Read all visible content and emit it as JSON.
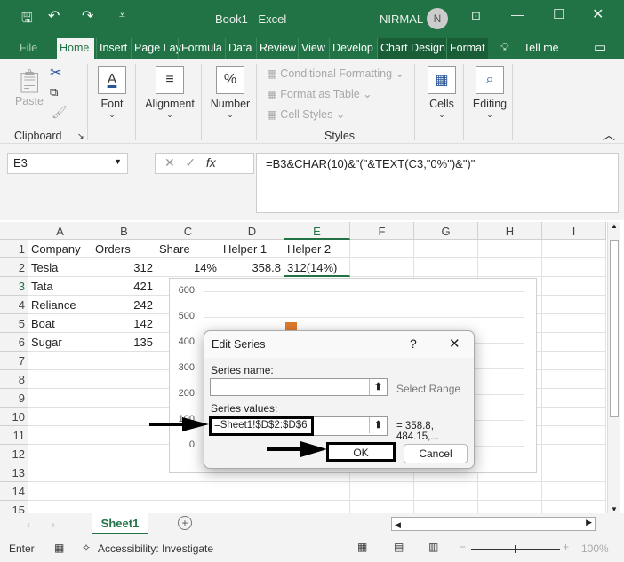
{
  "titlebar": {
    "title": "Book1  -  Excel",
    "user": "NIRMAL",
    "avatar": "N"
  },
  "tabs": [
    "File",
    "Home",
    "Insert",
    "Page Lay",
    "Formula",
    "Data",
    "Review",
    "View",
    "Develop",
    "Chart Design",
    "Format",
    "Tell me"
  ],
  "ribbon": {
    "paste": "Paste",
    "clipboard": "Clipboard",
    "font": "Font",
    "alignment": "Alignment",
    "number": "Number",
    "conditional": "Conditional Formatting",
    "format_table": "Format as Table",
    "cell_styles": "Cell Styles",
    "styles": "Styles",
    "cells": "Cells",
    "editing": "Editing"
  },
  "formula_bar": {
    "name_box": "E3",
    "formula": "=B3&CHAR(10)&\"(\"&TEXT(C3,\"0%\")&\")\""
  },
  "columns": [
    "A",
    "B",
    "C",
    "D",
    "E",
    "F",
    "G",
    "H",
    "I"
  ],
  "rows": [
    [
      "Company",
      "Orders",
      "Share",
      "Helper 1",
      "Helper 2"
    ],
    [
      "Tesla",
      "312",
      "14%",
      "358.8",
      "312(14%)"
    ],
    [
      "Tata",
      "421",
      "",
      "",
      ""
    ],
    [
      "Reliance",
      "242",
      "",
      "",
      ""
    ],
    [
      "Boat",
      "142",
      "",
      "",
      ""
    ],
    [
      "Sugar",
      "135",
      "",
      "",
      ""
    ]
  ],
  "row_numbers": [
    "1",
    "2",
    "3",
    "4",
    "5",
    "6",
    "7",
    "8",
    "9",
    "10",
    "11",
    "12",
    "13",
    "14",
    "15"
  ],
  "chart": {
    "y_ticks": [
      "600",
      "500",
      "400",
      "300",
      "200",
      "100",
      "0"
    ],
    "marker_color": "#e07b2c"
  },
  "dialog": {
    "title": "Edit Series",
    "help": "?",
    "series_name_label": "Series name:",
    "series_name_value": "",
    "select_range": "Select Range",
    "series_values_label": "Series values:",
    "series_values_value": "=Sheet1!$D$2:$D$6",
    "series_values_preview": "= 358.8, 484.15,...",
    "ok": "OK",
    "cancel": "Cancel"
  },
  "sheet_tabs": [
    "Sheet1"
  ],
  "status": {
    "mode": "Enter",
    "accessibility": "Accessibility: Investigate",
    "zoom": "100%"
  },
  "colors": {
    "accent": "#217346"
  }
}
